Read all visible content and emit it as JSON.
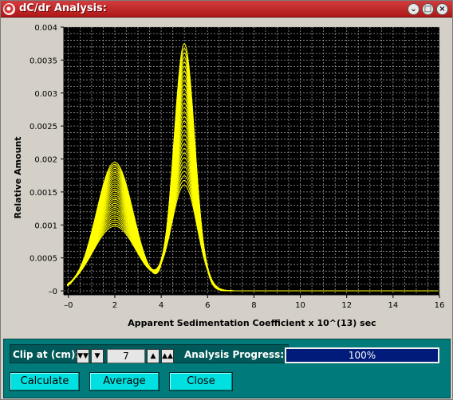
{
  "window": {
    "title": "dC/dr Analysis:"
  },
  "titlebar_buttons": [
    {
      "name": "minimize-button",
      "glyph": "⌄"
    },
    {
      "name": "maximize-button",
      "glyph": "□"
    },
    {
      "name": "close-window-button",
      "glyph": "×"
    }
  ],
  "chart_data": {
    "type": "line",
    "xlabel": "Apparent Sedimentation Coefficient x 10^(13) sec",
    "ylabel": "Relative Amount",
    "xlim": [
      -0.2,
      16
    ],
    "ylim": [
      -6e-05,
      0.004
    ],
    "x_ticks": [
      0,
      2,
      4,
      6,
      8,
      10,
      12,
      14,
      16
    ],
    "x_tick_labels": [
      "–0",
      "2",
      "4",
      "6",
      "8",
      "10",
      "12",
      "14",
      "16"
    ],
    "y_ticks": [
      0,
      0.0005,
      0.001,
      0.0015,
      0.002,
      0.0025,
      0.003,
      0.0035,
      0.004
    ],
    "y_tick_labels": [
      "–0",
      "0.0005",
      "0.001",
      "0.0015",
      "0.002",
      "0.0025",
      "0.003",
      "0.0035",
      "0.004"
    ],
    "grid": true,
    "background": "#000000",
    "line_color": "#ffff00",
    "curve_family": {
      "count": 32,
      "peak1_center": 2.0,
      "peak1_height_range": [
        0.00098,
        0.00195
      ],
      "peak2_center": 5.0,
      "peak2_height_range": [
        0.0016,
        0.00375
      ],
      "valley_x": 3.8,
      "tail_end_x": 7.6
    }
  },
  "controls": {
    "clip_label": "Clip at (cm):",
    "clip_value": "7",
    "progress_label": "Analysis Progress:",
    "progress_fraction": 1.0,
    "progress_text": "100%",
    "buttons": {
      "calculate": "Calculate",
      "average": "Average",
      "close": "Close"
    }
  },
  "colors": {
    "title_bar": "#c02020",
    "panel": "#007a7a",
    "button": "#00e0e0",
    "progress_fill": "#001b7a"
  }
}
